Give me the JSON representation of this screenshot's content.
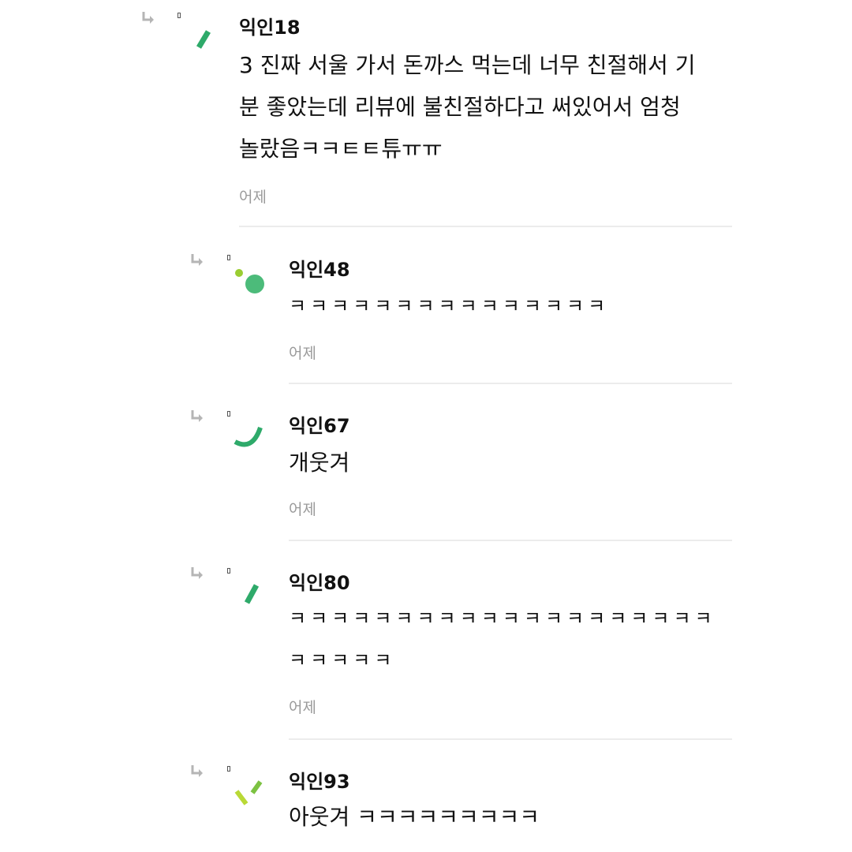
{
  "comments": [
    {
      "author": "익인18",
      "lines": [
        "3 진짜 서울 가서 돈까스 먹는데 너무 친절해서 기",
        "분 좋았는데 리뷰에 불친절하다고 써있어서 엄청",
        "놀랐음ㅋㅋㅌㅌ튜ㅠㅠ"
      ],
      "time": "어제",
      "avatar_icon": "green-dash-avatar-icon"
    },
    {
      "author": "익인48",
      "lines": [
        "ㅋㅋㅋㅋㅋㅋㅋㅋㅋㅋㅋㅋㅋㅋㅋ"
      ],
      "time": "어제",
      "avatar_icon": "green-dots-avatar-icon"
    },
    {
      "author": "익인67",
      "lines": [
        "개웃겨"
      ],
      "time": "어제",
      "avatar_icon": "green-arc-avatar-icon"
    },
    {
      "author": "익인80",
      "lines": [
        "ㅋㅋㅋㅋㅋㅋㅋㅋㅋㅋㅋㅋㅋㅋㅋㅋㅋㅋㅋㅋ",
        "ㅋㅋㅋㅋㅋ"
      ],
      "time": "어제",
      "avatar_icon": "green-dash-avatar-icon"
    },
    {
      "author": "익인93",
      "lines": [
        "아웃겨 ㅋㅋㅋㅋㅋㅋㅋㅋㅋ"
      ],
      "time": "",
      "avatar_icon": "yellow-green-dashes-avatar-icon"
    }
  ],
  "colors": {
    "accent_green": "#2eaa6a",
    "light_green": "#9acd32",
    "timestamp_gray": "#9a9a9a",
    "divider_gray": "#ececec",
    "reply_arrow_gray": "#b5b5b5"
  }
}
